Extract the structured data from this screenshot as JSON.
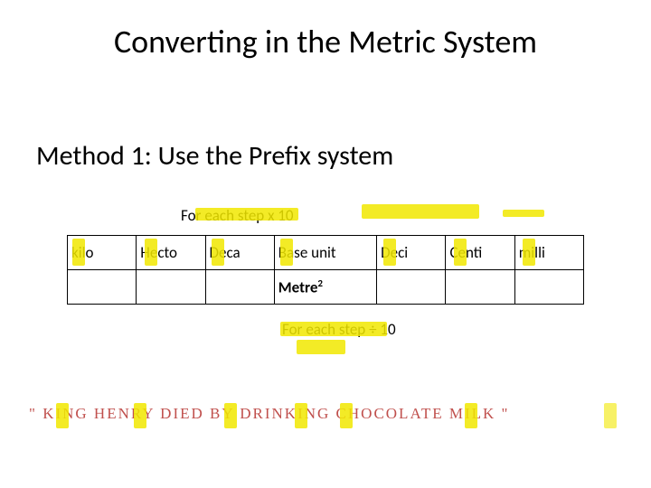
{
  "title": "Converting in the Metric System",
  "subtitle": "Method 1: Use the Prefix system",
  "above_text": "For each step x 10",
  "below_text": "For each step ÷ 10",
  "prefixes": {
    "kilo": "kilo",
    "hecto": "Hecto",
    "deca": "Deca",
    "base": "Base unit",
    "deci": "Deci",
    "centi": "Centi",
    "milli": "milli"
  },
  "base_example_prefix": "Metre",
  "base_example_power": "2",
  "mnemonic": "\" KING HENRY DIED BY DRINKING CHOCOLATE MILK \""
}
